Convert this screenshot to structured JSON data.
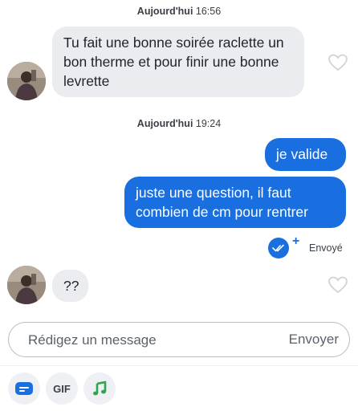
{
  "conversation": {
    "timestamp1": {
      "day": "Aujourd'hui",
      "time": "16:56"
    },
    "msg1": "Tu fait une bonne soirée raclette un bon therme et pour finir une bonne levrette",
    "timestamp2": {
      "day": "Aujourd'hui",
      "time": "19:24"
    },
    "msg2": "je valide",
    "msg3": "juste une question, il faut combien de cm pour rentrer",
    "status": "Envoyé",
    "msg4": "??"
  },
  "composer": {
    "placeholder": "Rédigez un message",
    "send_label": "Envoyer"
  },
  "toolbar": {
    "gif_label": "GIF",
    "icons": [
      "sticker-icon",
      "gif-icon",
      "music-icon"
    ]
  },
  "colors": {
    "accent": "#1a6fe0",
    "incoming_bubble": "#eaecf0"
  }
}
